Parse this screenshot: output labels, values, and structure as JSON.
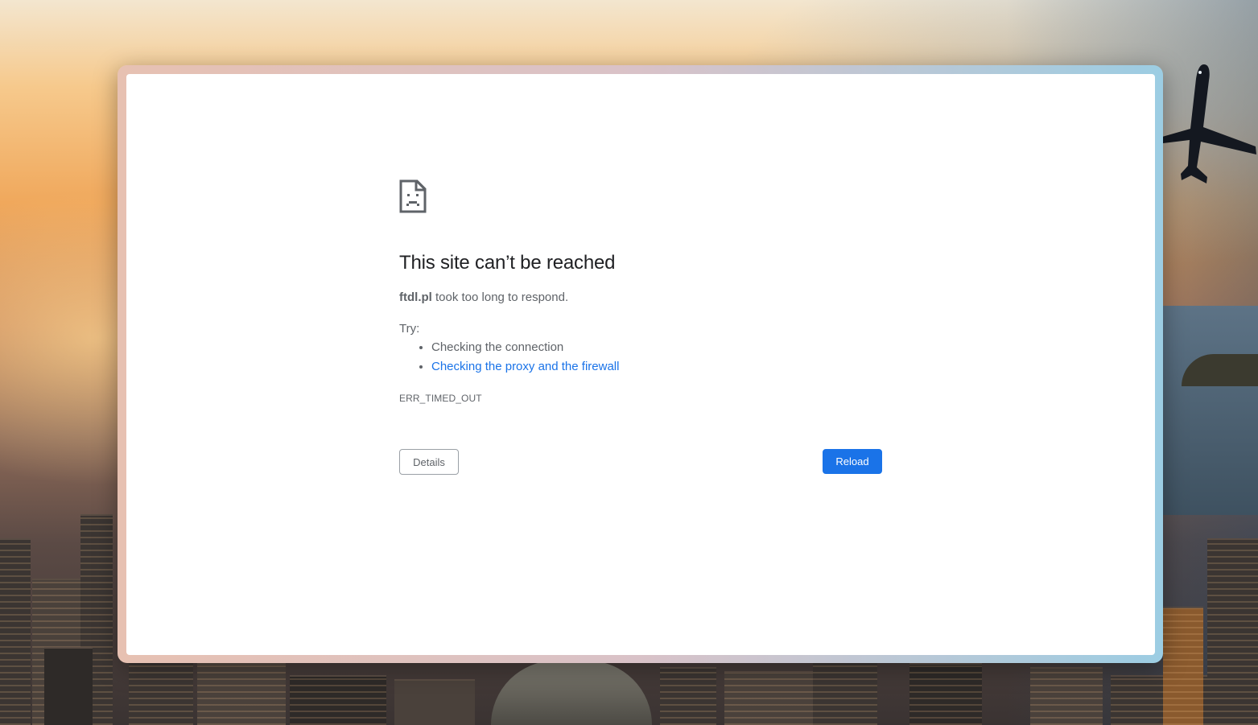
{
  "page": {
    "heading": "This site can’t be reached",
    "host": "ftdl.pl",
    "summary_suffix": " took too long to respond.",
    "try_label": "Try:",
    "suggestions": [
      {
        "label": "Checking the connection",
        "is_link": false
      },
      {
        "label": "Checking the proxy and the firewall",
        "is_link": true
      }
    ],
    "error_code": "ERR_TIMED_OUT",
    "details_button_label": "Details",
    "reload_button_label": "Reload",
    "icon": "sad-page-icon"
  },
  "colors": {
    "heading_text": "#202124",
    "body_text": "#5f6368",
    "link": "#1a73e8",
    "primary_button": "#1a73e8",
    "content_background": "#ffffff"
  }
}
